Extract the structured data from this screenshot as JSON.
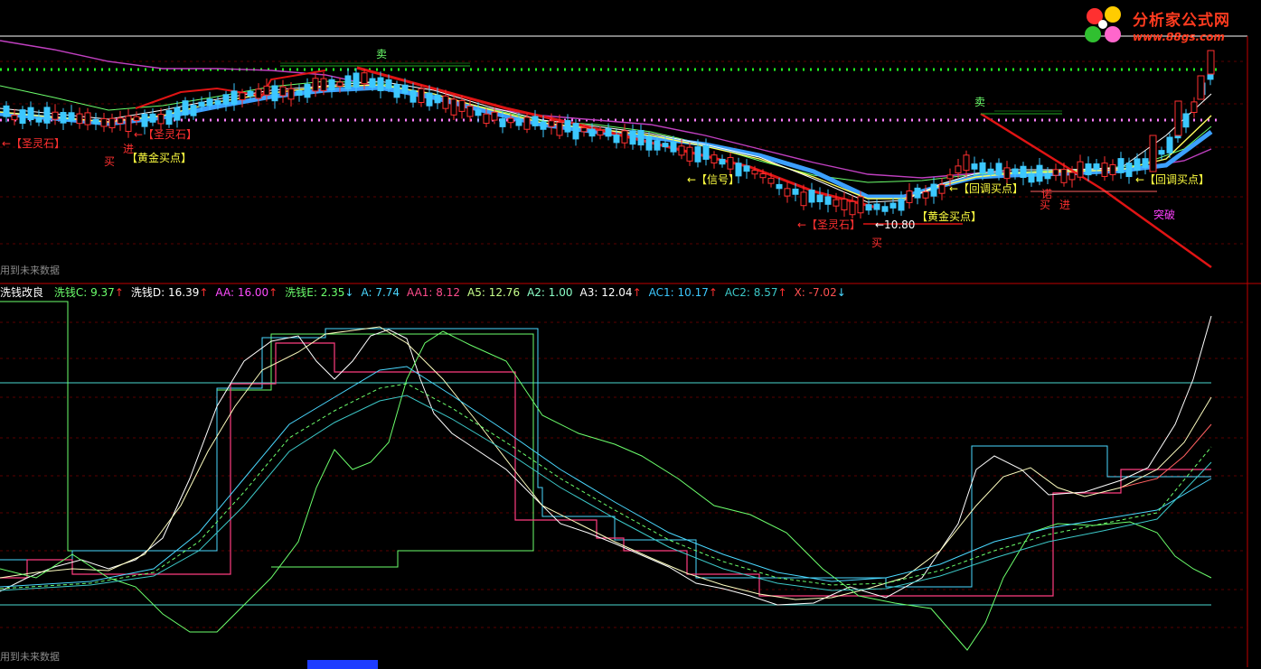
{
  "logo": {
    "title": "分析家公式网",
    "url": "www.88gs.com"
  },
  "main_chart": {
    "future_note": "用到未来数据",
    "annotations": {
      "sell1": "卖",
      "sell2": "卖",
      "stone_left": "←【圣灵石】",
      "buy1": "买",
      "enter1": "进",
      "stone2": "←【圣灵石】",
      "gold1": "【黄金买点】",
      "signal": "←【信号】",
      "stone3": "←【圣灵石】",
      "low_price": "←10.80",
      "buy2": "买",
      "gold2": "【黄金买点】",
      "pullback1": "←【回调买点】",
      "buy3": "买",
      "enter2": "进",
      "buy_stack": "诺",
      "pullback2": "←【回调买点】",
      "breakout": "突破"
    }
  },
  "indicator": {
    "name": "洗钱改良",
    "values": [
      {
        "label": "洗钱C:",
        "value": "9.37",
        "arrow": "↑",
        "color": "#6cff6c"
      },
      {
        "label": "洗钱D:",
        "value": "16.39",
        "arrow": "↑",
        "color": "#ffffff"
      },
      {
        "label": "AA:",
        "value": "16.00",
        "arrow": "↑",
        "color": "#ff4cff"
      },
      {
        "label": "洗钱E:",
        "value": "2.35",
        "arrow": "↓",
        "color": "#6cff6c"
      },
      {
        "label": "A:",
        "value": "7.74",
        "arrow": "",
        "color": "#4ad8ff"
      },
      {
        "label": "AA1:",
        "value": "8.12",
        "arrow": "",
        "color": "#ff4c8c"
      },
      {
        "label": "A5:",
        "value": "12.76",
        "arrow": "",
        "color": "#c8ff8c"
      },
      {
        "label": "A2:",
        "value": "1.00",
        "arrow": "",
        "color": "#8cffc8"
      },
      {
        "label": "A3:",
        "value": "12.04",
        "arrow": "↑",
        "color": "#ffffff"
      },
      {
        "label": "AC1:",
        "value": "10.17",
        "arrow": "↑",
        "color": "#3cc8ff"
      },
      {
        "label": "AC2:",
        "value": "8.57",
        "arrow": "↑",
        "color": "#3cc8c8"
      },
      {
        "label": "X:",
        "value": "-7.02",
        "arrow": "↓",
        "color": "#ff5050"
      }
    ],
    "future_note": "用到未来数据"
  },
  "colors": {
    "up": "#ff3030",
    "down": "#3cc8ff",
    "ma_blue": "#3ca0ff",
    "dot_green": "#22ff22",
    "dot_pink": "#ff7cff",
    "trend_red": "#e01414",
    "grid": "#5a0000"
  }
}
